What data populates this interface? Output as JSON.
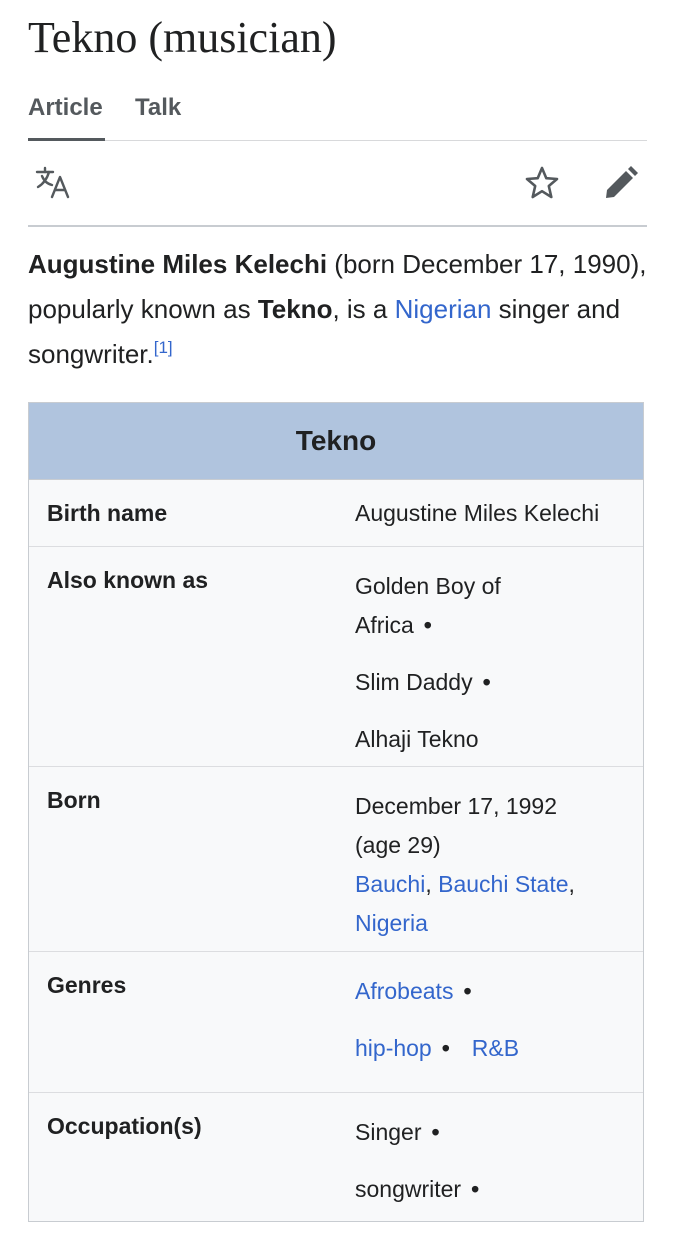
{
  "page": {
    "title": "Tekno (musician)",
    "tabs": [
      "Article",
      "Talk"
    ]
  },
  "toolbar": {
    "icons": [
      "translate-icon",
      "star-icon",
      "edit-pencil-icon"
    ]
  },
  "lead": {
    "name_bold": "Augustine Miles Kelechi",
    "t1": " (born December 17, 1990), popularly known as ",
    "alias_bold": "Tekno",
    "t2": ", is a ",
    "nationality_link": "Nigerian",
    "t3": " singer and songwriter.",
    "ref": "[1]"
  },
  "infobox": {
    "title": "Tekno",
    "birth_name": {
      "label": "Birth name",
      "value": "Augustine Miles Kelechi"
    },
    "aka": {
      "label": "Also known as",
      "line1": "Golden Boy of",
      "line2": "Africa",
      "line3": "Slim Daddy",
      "line4": "Alhaji Tekno"
    },
    "born": {
      "label": "Born",
      "date": "December 17, 1992",
      "age": "(age 29)",
      "place1": "Bauchi",
      "place2": "Bauchi State",
      "place3": "Nigeria"
    },
    "genres": {
      "label": "Genres",
      "g1": "Afrobeats",
      "g2": "hip-hop",
      "g3": "R&B"
    },
    "occupation": {
      "label": "Occupation(s)",
      "o1": "Singer",
      "o2": "songwriter"
    },
    "separator": "•",
    "comma": ","
  },
  "colors": {
    "link": "#3366cc",
    "infobox_header": "#b0c4de",
    "text": "#202122"
  }
}
